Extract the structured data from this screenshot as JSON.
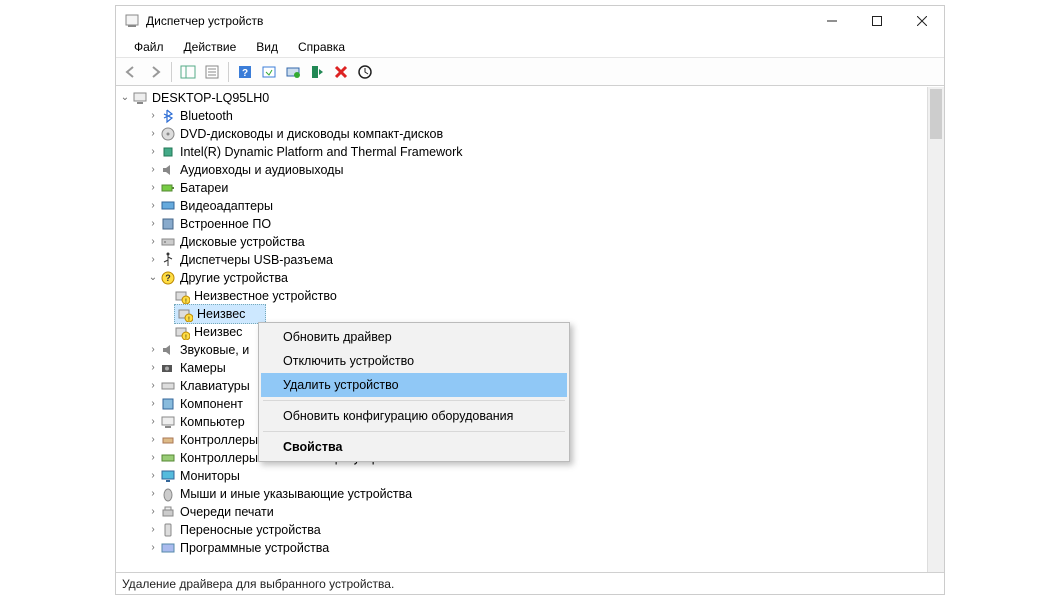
{
  "window": {
    "title": "Диспетчер устройств"
  },
  "menu": {
    "file": "Файл",
    "action": "Действие",
    "view": "Вид",
    "help": "Справка"
  },
  "tree": {
    "root": "DESKTOP-LQ95LH0",
    "items": [
      "Bluetooth",
      "DVD-дисководы и дисководы компакт-дисков",
      "Intel(R) Dynamic Platform and Thermal Framework",
      "Аудиовходы и аудиовыходы",
      "Батареи",
      "Видеоадаптеры",
      "Встроенное ПО",
      "Дисковые устройства",
      "Диспетчеры USB-разъема",
      "Другие устройства",
      "Звуковые, и",
      "Камеры",
      "Клавиатуры",
      "Компонент",
      "Компьютер",
      "Контроллеры",
      "Контроллеры запоминающих устройств",
      "Мониторы",
      "Мыши и иные указывающие устройства",
      "Очереди печати",
      "Переносные устройства",
      "Программные устройства"
    ],
    "other_children": [
      "Неизвестное устройство",
      "Неизвес",
      "Неизвес"
    ]
  },
  "context": {
    "update": "Обновить драйвер",
    "disable": "Отключить устройство",
    "uninstall": "Удалить устройство",
    "rescan": "Обновить конфигурацию оборудования",
    "properties": "Свойства"
  },
  "status": "Удаление драйвера для выбранного устройства."
}
